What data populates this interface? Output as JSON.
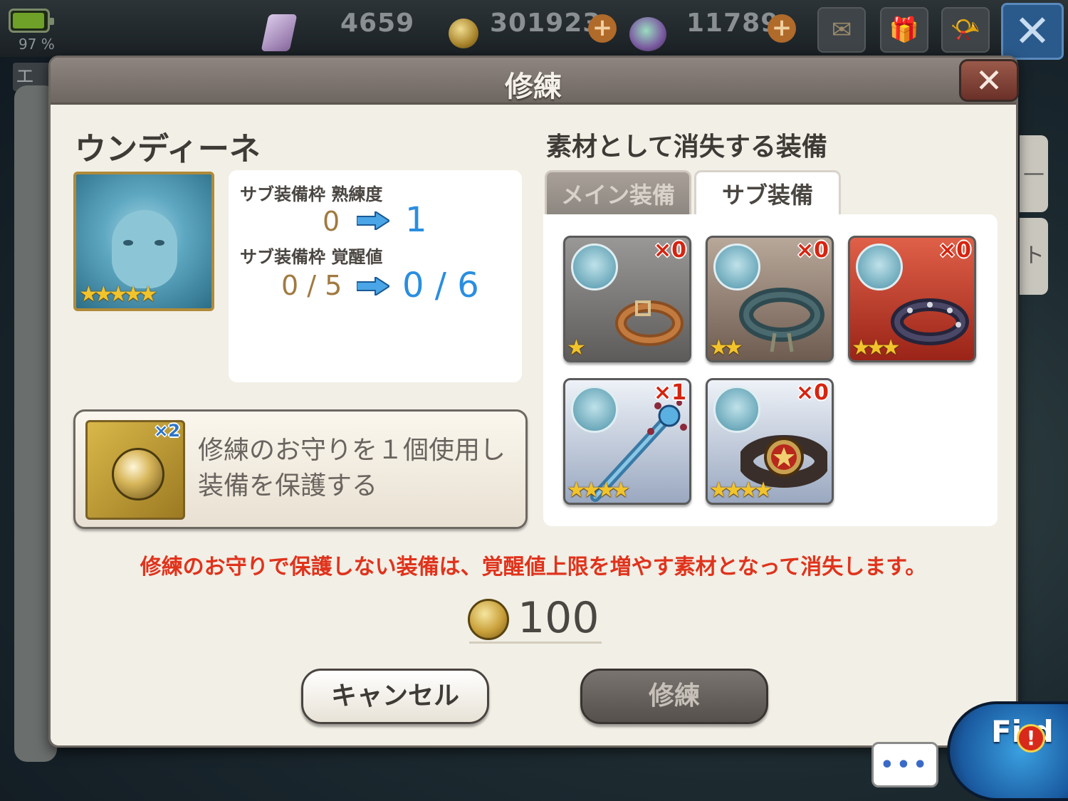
{
  "status_bar": {
    "battery_percent": "97 %",
    "battery_level": 0.97,
    "crystal_count": "4659",
    "gil_count": "301923",
    "gem_count": "11789",
    "side_label": "エ"
  },
  "modal": {
    "title": "修練",
    "close_label": "✕",
    "character": {
      "name": "ウンディーネ",
      "rarity_stars": "★★★★★"
    },
    "stats": {
      "proficiency_label": "サブ装備枠 熟練度",
      "proficiency_from": "0",
      "proficiency_to": "1",
      "awakening_label": "サブ装備枠 覚醒値",
      "awakening_from": "0 / 5",
      "awakening_to": "0 / 6"
    },
    "materials": {
      "title": "素材として消失する装備",
      "tabs": [
        {
          "label": "メイン装備",
          "active": false
        },
        {
          "label": "サブ装備",
          "active": true
        }
      ],
      "items": [
        {
          "count": "×0",
          "stars": "★",
          "icon": "brown-belt-icon"
        },
        {
          "count": "×0",
          "stars": "★★",
          "icon": "corset-belt-icon"
        },
        {
          "count": "×0",
          "stars": "★★★",
          "icon": "studded-belt-icon"
        },
        {
          "count": "×1",
          "stars": "★★★★",
          "icon": "flower-staff-icon"
        },
        {
          "count": "×0",
          "stars": "★★★★",
          "icon": "champion-belt-icon"
        }
      ]
    },
    "charm": {
      "count": "×2",
      "line1": "修練のお守りを１個使用し",
      "line2": "装備を保護する"
    },
    "warning": "修練のお守りで保護しない装備は、覚醒値上限を増やす素材となって消失します。",
    "cost": "100",
    "buttons": {
      "cancel": "キャンセル",
      "confirm": "修練"
    }
  },
  "overlay": {
    "chat_dots": "•••",
    "field_label": "Fi d",
    "field_alert": "!"
  },
  "colors": {
    "warning": "#e0331c",
    "value_new": "#2a8ee0",
    "value_old": "#a07a40",
    "star": "#f2c42c"
  }
}
